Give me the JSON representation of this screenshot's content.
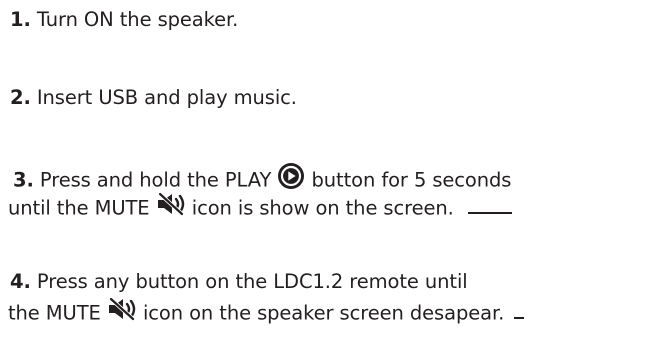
{
  "steps": [
    {
      "number": "1.",
      "text": "Turn ON the speaker."
    },
    {
      "number": "2.",
      "text": "Insert USB and play music."
    },
    {
      "number": "3.",
      "line1_before": "Press and hold the PLAY",
      "line1_after": "button for 5 seconds",
      "line2_before": "until the MUTE",
      "line2_after": "icon is show on the screen."
    },
    {
      "number": "4.",
      "line1": "Press any button on the LDC1.2 remote until",
      "line2_before": "the MUTE",
      "line2_after": "icon on the speaker screen desapear."
    }
  ],
  "icons": {
    "play": "play-icon",
    "mute": "mute-icon"
  },
  "colors": {
    "text": "#231f20",
    "background": "#ffffff"
  }
}
